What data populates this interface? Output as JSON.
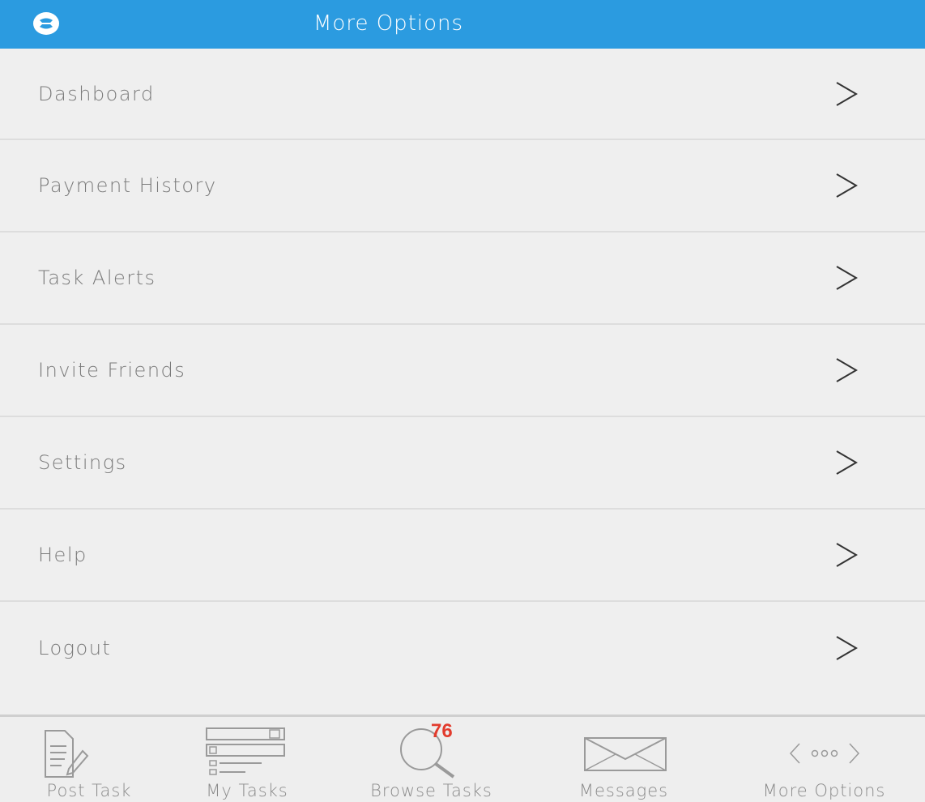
{
  "header": {
    "title": "More Options",
    "logo_icon": "app-logo-icon",
    "background_color": "#2b9be0"
  },
  "menu": {
    "items": [
      {
        "label": "Dashboard",
        "icon": "chevron-right-icon"
      },
      {
        "label": "Payment History",
        "icon": "chevron-right-icon"
      },
      {
        "label": "Task Alerts",
        "icon": "chevron-right-icon"
      },
      {
        "label": "Invite Friends",
        "icon": "chevron-right-icon"
      },
      {
        "label": "Settings",
        "icon": "chevron-right-icon"
      },
      {
        "label": "Help",
        "icon": "chevron-right-icon"
      },
      {
        "label": "Logout",
        "icon": "chevron-right-icon"
      }
    ]
  },
  "tabbar": {
    "tabs": [
      {
        "label": "Post Task",
        "icon": "post-task-icon"
      },
      {
        "label": "My Tasks",
        "icon": "my-tasks-icon"
      },
      {
        "label": "Browse Tasks",
        "icon": "browse-tasks-icon",
        "badge": "76"
      },
      {
        "label": "Messages",
        "icon": "envelope-icon"
      },
      {
        "label": "More Options",
        "icon": "more-options-icon"
      }
    ]
  },
  "colors": {
    "accent": "#2b9be0",
    "badge": "#e23b2d",
    "text": "#7a7a7a"
  }
}
